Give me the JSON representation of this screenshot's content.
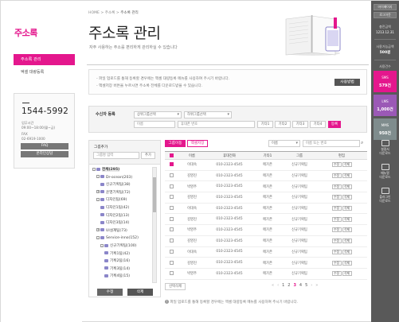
{
  "sidebar": {
    "logo": "주소록",
    "menu": [
      {
        "label": "주소록 관리",
        "active": true
      },
      {
        "label": "엑셀 대량등록",
        "active": false
      }
    ],
    "cs": {
      "phone": "1544-5992",
      "hours_label": "업무시간",
      "hours": "09:00~18:00(월~금)",
      "fax_label": "FAX",
      "fax": "02-6919-1000",
      "faq": "FAQ",
      "chat": "온라인상담"
    }
  },
  "header": {
    "breadcrumb": [
      "HOME",
      "주소록",
      "주소록 관리"
    ],
    "title": "주소록 관리",
    "subtitle": "자주 사용하는 주소를 편리하게 관리하실 수 있습니다"
  },
  "notice": {
    "lines": [
      "- 파일 업로드를 통해 등록할 경우에는 엑셀 대량등록 메뉴를 사용하여 주시기 바랍니다.",
      "- 엑셀저장 버튼을 누르시면 주소록 전체를 다운로드받을 수 있습니다."
    ],
    "guide_button": "사용방법"
  },
  "recv": {
    "label": "수신자 등록",
    "group_select": "상위그룹선택",
    "subgroup_select": "하위그룹선택",
    "name_placeholder": "이름",
    "phone_placeholder": "휴대폰 번호",
    "etc": [
      "기타1",
      "기타2",
      "기타3",
      "기타4"
    ],
    "register": "등록"
  },
  "groups": {
    "label": "그룹추가",
    "add_input": "그룹명 입력",
    "add_button": "추가",
    "tree": [
      {
        "label": "전체(295)",
        "level": 0,
        "toggle": "-",
        "selected": true,
        "bold": true
      },
      {
        "label": "Dr-ocean(203)",
        "level": 1,
        "toggle": "-"
      },
      {
        "label": "신규기획팀(38)",
        "level": 2,
        "toggle": ""
      },
      {
        "label": "운영기획팀(72)",
        "level": 1,
        "toggle": "+"
      },
      {
        "label": "디자인팀(69)",
        "level": 1,
        "toggle": "-"
      },
      {
        "label": "디자인1팀(42)",
        "level": 2,
        "toggle": ""
      },
      {
        "label": "디자인2팀(13)",
        "level": 2,
        "toggle": ""
      },
      {
        "label": "디자인3팀(14)",
        "level": 2,
        "toggle": ""
      },
      {
        "label": "UI설계팀(73)",
        "level": 1,
        "toggle": "+"
      },
      {
        "label": "Service-inno(152)",
        "level": 1,
        "toggle": "-"
      },
      {
        "label": "신규기획팀(100)",
        "level": 2,
        "toggle": "-"
      },
      {
        "label": "기획1팀(42)",
        "level": 3,
        "toggle": ""
      },
      {
        "label": "기획2팀(16)",
        "level": 3,
        "toggle": ""
      },
      {
        "label": "기획3팀(14)",
        "level": 3,
        "toggle": ""
      },
      {
        "label": "기획4팀(15)",
        "level": 3,
        "toggle": ""
      }
    ],
    "edit_button": "수정",
    "delete_button": "삭제"
  },
  "list": {
    "tab_group_move": "그룹이동",
    "tab_excel": "엑셀저장",
    "search_select": "이름",
    "search_placeholder": "이름 또는 번호",
    "columns": [
      "이름",
      "휴대전화",
      "기타1",
      "그룹",
      "편집"
    ],
    "edit_label": "수정",
    "delete_label": "삭제",
    "rows": [
      {
        "name": "이대숙",
        "phone": "010-2323-4545",
        "etc": "메가존",
        "group": "신규기획팀",
        "checked": true
      },
      {
        "name": "김영진",
        "phone": "010-2323-4545",
        "etc": "메가존",
        "group": "신규기획팀",
        "checked": false
      },
      {
        "name": "박영주",
        "phone": "010-2323-4545",
        "etc": "메가존",
        "group": "신규기획팀",
        "checked": false
      },
      {
        "name": "김영진",
        "phone": "010-2323-4545",
        "etc": "메가존",
        "group": "신규기획팀",
        "checked": false
      },
      {
        "name": "이대숙",
        "phone": "010-2323-4545",
        "etc": "메가존",
        "group": "신규기획팀",
        "checked": false
      },
      {
        "name": "김영진",
        "phone": "010-2323-4545",
        "etc": "메가존",
        "group": "신규기획팀",
        "checked": false
      },
      {
        "name": "박영주",
        "phone": "010-2323-4545",
        "etc": "메가존",
        "group": "신규기획팀",
        "checked": false
      },
      {
        "name": "김영진",
        "phone": "010-2323-4545",
        "etc": "메가존",
        "group": "신규기획팀",
        "checked": false
      },
      {
        "name": "이대숙",
        "phone": "010-2323-4545",
        "etc": "메가존",
        "group": "신규기획팀",
        "checked": false
      },
      {
        "name": "김영진",
        "phone": "010-2323-4545",
        "etc": "메가존",
        "group": "신규기획팀",
        "checked": false
      },
      {
        "name": "박영주",
        "phone": "010-2323-4545",
        "etc": "메가존",
        "group": "신규기획팀",
        "checked": false
      }
    ],
    "delete_selected": "선택삭제",
    "pages": [
      "1",
      "2",
      "3",
      "4",
      "5"
    ],
    "current_page": "3",
    "footnote": "파일 업로드를 통해 등록할 경우에는 엑셀 대량등록 메뉴를 사용하여 주시기 바랍니다."
  },
  "rightbar": {
    "mypage": "마이페이지",
    "logout": "로그아웃",
    "charge_label": "충전금액",
    "charge_date": "1213.12.31",
    "usable_label": "사용가능금액",
    "usable_value": "500원",
    "usage_label": "사용건수",
    "cards": [
      {
        "label": "SMS",
        "value": "579건",
        "color": "#e4178d"
      },
      {
        "label": "LMS",
        "value": "1,000건",
        "color": "#9b59b6"
      },
      {
        "label": "MMS",
        "value": "950건",
        "color": "#7f8c8d"
      }
    ],
    "links": [
      "설정서\n다운로드",
      "매뉴얼\n다운로드",
      "플러그인\n다운로드"
    ]
  },
  "colors": {
    "accent": "#e4178d",
    "sidebar_dark": "#595959"
  }
}
